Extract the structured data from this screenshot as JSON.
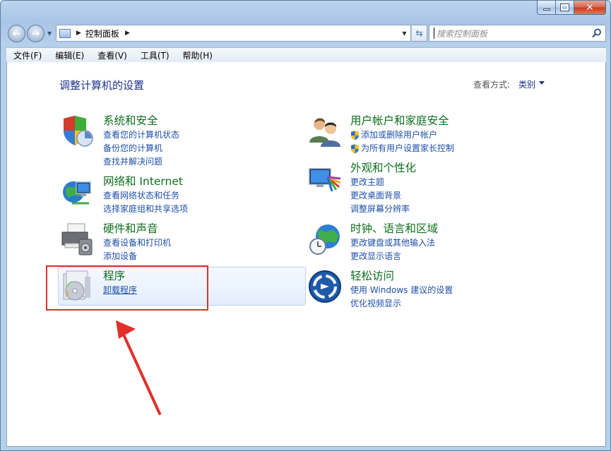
{
  "window": {
    "min_label": "",
    "max_label": "",
    "close_label": ""
  },
  "address": {
    "path": "控制面板",
    "search_placeholder": "搜索控制面板"
  },
  "menu": [
    "文件(F)",
    "编辑(E)",
    "查看(V)",
    "工具(T)",
    "帮助(H)"
  ],
  "page": {
    "heading": "调整计算机的设置",
    "view_by_label": "查看方式:",
    "view_by_value": "类别"
  },
  "categories": {
    "system": {
      "title": "系统和安全",
      "links": [
        "查看您的计算机状态",
        "备份您的计算机",
        "查找并解决问题"
      ]
    },
    "network": {
      "title": "网络和 Internet",
      "links": [
        "查看网络状态和任务",
        "选择家庭组和共享选项"
      ]
    },
    "hardware": {
      "title": "硬件和声音",
      "links": [
        "查看设备和打印机",
        "添加设备"
      ]
    },
    "programs": {
      "title": "程序",
      "links": [
        "卸载程序"
      ]
    },
    "users": {
      "title": "用户帐户和家庭安全",
      "links": [
        "添加或删除用户帐户",
        "为所有用户设置家长控制"
      ]
    },
    "appearance": {
      "title": "外观和个性化",
      "links": [
        "更改主题",
        "更改桌面背景",
        "调整屏幕分辨率"
      ]
    },
    "clock": {
      "title": "时钟、语言和区域",
      "links": [
        "更改键盘或其他输入法",
        "更改显示语言"
      ]
    },
    "ease": {
      "title": "轻松访问",
      "links": [
        "使用 Windows 建议的设置",
        "优化视频显示"
      ]
    }
  },
  "colors": {
    "title_green": "#0d6e1e",
    "link_blue": "#1e4fa8",
    "highlight_red": "#e0302b"
  }
}
